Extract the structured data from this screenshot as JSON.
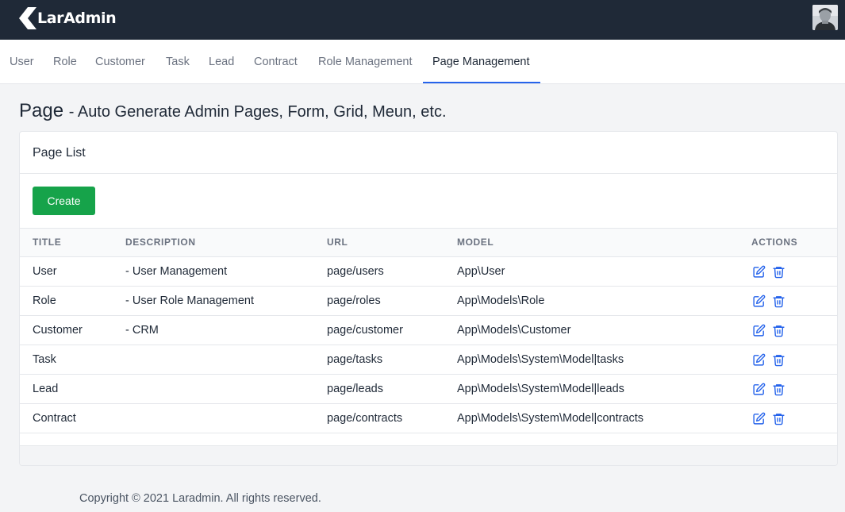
{
  "brand": {
    "name": "LarAdmin"
  },
  "user": {
    "avatar_icon": "user-avatar-photo"
  },
  "nav": {
    "items": [
      {
        "label": "User"
      },
      {
        "label": "Role"
      },
      {
        "label": "Customer"
      },
      {
        "label": "Task"
      },
      {
        "label": "Lead"
      },
      {
        "label": "Contract"
      },
      {
        "label": "Role Management"
      },
      {
        "label": "Page Management"
      }
    ],
    "active": "Page Management"
  },
  "page": {
    "title": "Page",
    "subtitle": "- Auto Generate Admin Pages, Form, Grid, Meun, etc."
  },
  "card": {
    "title": "Page List",
    "create_label": "Create"
  },
  "table": {
    "columns": [
      "TITLE",
      "DESCRIPTION",
      "URL",
      "MODEL",
      "ACTIONS"
    ],
    "rows": [
      {
        "title": "User",
        "description": "- User Management",
        "url": "page/users",
        "model": "App\\User"
      },
      {
        "title": "Role",
        "description": "- User Role Management",
        "url": "page/roles",
        "model": "App\\Models\\Role"
      },
      {
        "title": "Customer",
        "description": "- CRM",
        "url": "page/customer",
        "model": "App\\Models\\Customer"
      },
      {
        "title": "Task",
        "description": "",
        "url": "page/tasks",
        "model": "App\\Models\\System\\Model|tasks"
      },
      {
        "title": "Lead",
        "description": "",
        "url": "page/leads",
        "model": "App\\Models\\System\\Model|leads"
      },
      {
        "title": "Contract",
        "description": "",
        "url": "page/contracts",
        "model": "App\\Models\\System\\Model|contracts"
      }
    ],
    "action_icons": [
      "edit-icon",
      "trash-icon"
    ]
  },
  "footer": {
    "copyright": "Copyright © 2021 Laradmin. All rights reserved."
  },
  "colors": {
    "topbar": "#1f2937",
    "primary": "#2563eb",
    "create_button": "#16a34a",
    "text": "#1f2937",
    "muted": "#6b7280"
  }
}
